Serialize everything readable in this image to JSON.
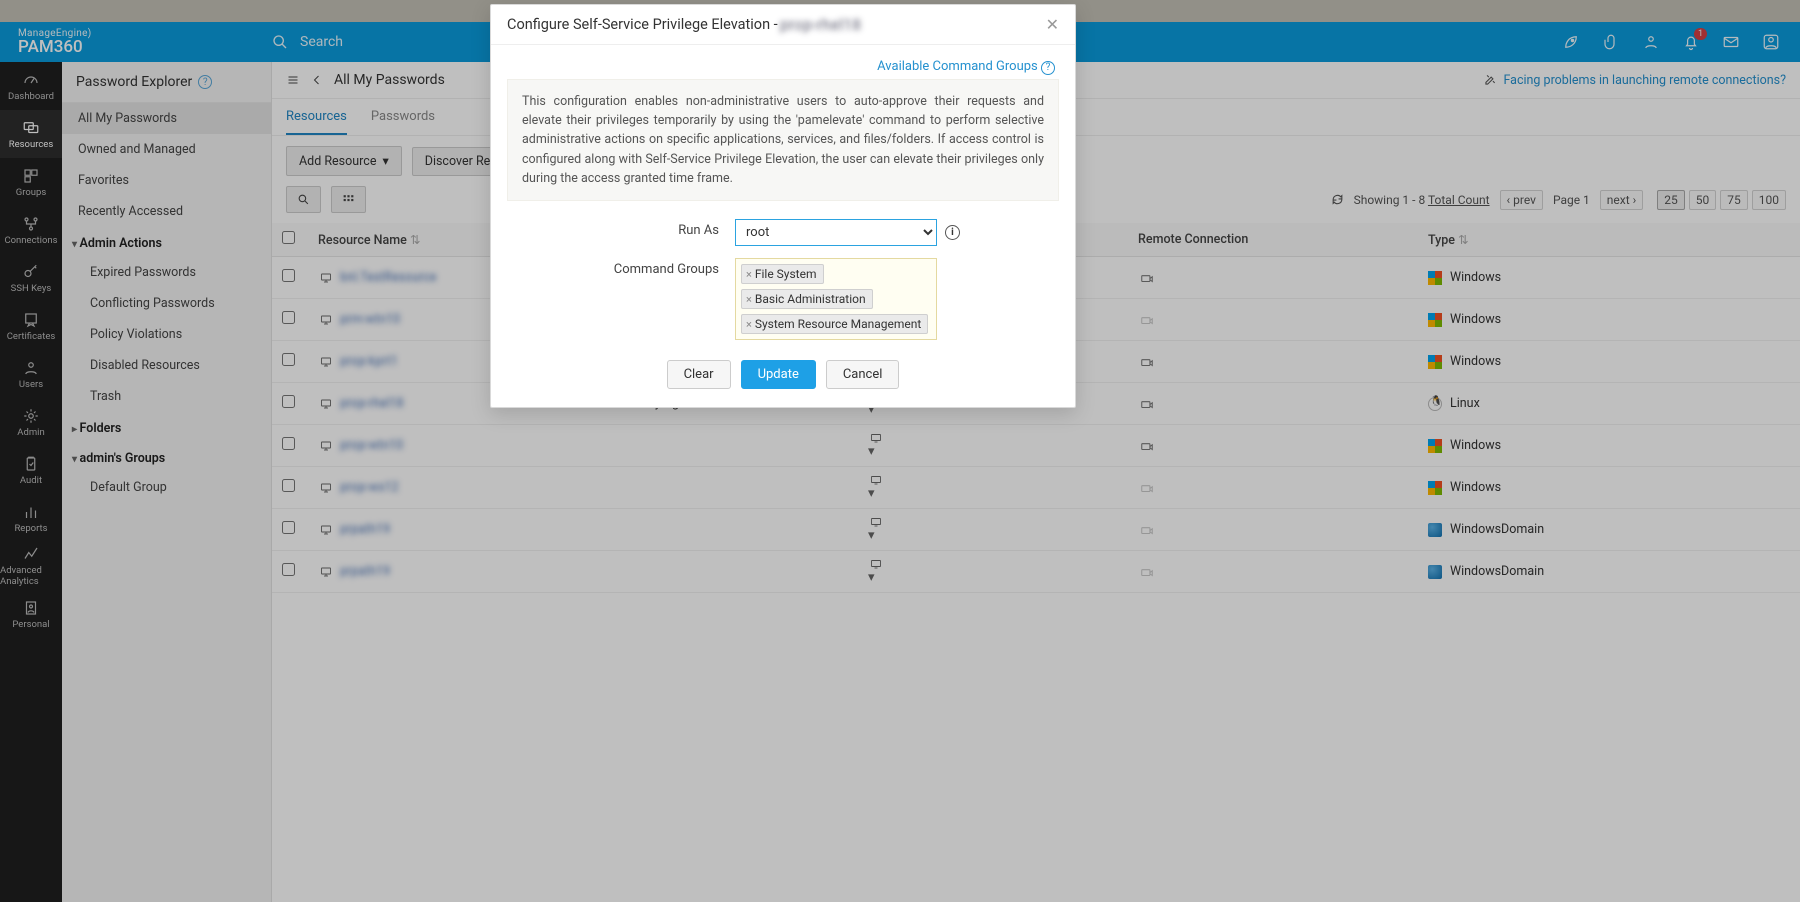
{
  "brand": {
    "sup": "ManageEngine)",
    "main": "PAM360"
  },
  "search": {
    "placeholder": "Search"
  },
  "header_icons": {
    "notifications_badge": "1"
  },
  "leftnav": [
    {
      "label": "Dashboard",
      "active": false,
      "icon": "gauge"
    },
    {
      "label": "Resources",
      "active": true,
      "icon": "monitors"
    },
    {
      "label": "Groups",
      "active": false,
      "icon": "groups"
    },
    {
      "label": "Connections",
      "active": false,
      "icon": "connections"
    },
    {
      "label": "SSH Keys",
      "active": false,
      "icon": "key"
    },
    {
      "label": "Certificates",
      "active": false,
      "icon": "cert"
    },
    {
      "label": "Users",
      "active": false,
      "icon": "user"
    },
    {
      "label": "Admin",
      "active": false,
      "icon": "gear"
    },
    {
      "label": "Audit",
      "active": false,
      "icon": "audit"
    },
    {
      "label": "Reports",
      "active": false,
      "icon": "reports"
    },
    {
      "label": "Advanced Analytics",
      "active": false,
      "icon": "analytics"
    },
    {
      "label": "Personal",
      "active": false,
      "icon": "personal"
    }
  ],
  "explorer": {
    "title": "Password Explorer",
    "items": [
      {
        "label": "All My Passwords",
        "active": true
      },
      {
        "label": "Owned and Managed"
      },
      {
        "label": "Favorites"
      },
      {
        "label": "Recently Accessed"
      }
    ],
    "admin_actions": {
      "title": "Admin Actions",
      "items": [
        "Expired Passwords",
        "Conflicting Passwords",
        "Policy Violations",
        "Disabled Resources",
        "Trash"
      ]
    },
    "folders": {
      "title": "Folders",
      "collapsed": true
    },
    "groups": {
      "title": "admin's Groups",
      "items": [
        "Default Group"
      ]
    }
  },
  "main": {
    "title": "All My Passwords",
    "help_link": "Facing problems in launching remote connections?",
    "tabs": [
      {
        "label": "Resources",
        "active": true
      },
      {
        "label": "Passwords",
        "active": false
      }
    ],
    "toolbar": {
      "add": "Add Resource",
      "discover": "Discover Resources"
    },
    "pager": {
      "showing": "Showing 1 - 8",
      "total_label": "Total Count",
      "prev": "prev",
      "page": "Page 1",
      "next": "next",
      "sizes": [
        "25",
        "50",
        "75",
        "100"
      ],
      "active_size": "25"
    },
    "columns": {
      "name": "Resource Name",
      "desc": "",
      "action": "",
      "remote": "Remote Connection",
      "type": "Type"
    },
    "rows": [
      {
        "name": "bnl.TestResource",
        "desc": "",
        "os": "win",
        "type": "Windows",
        "conn": "on"
      },
      {
        "name": "prm-wtn10",
        "desc": "",
        "os": "win",
        "type": "Windows",
        "conn": "dim"
      },
      {
        "name": "prop-kprt1",
        "desc": "",
        "os": "win",
        "type": "Windows",
        "conn": "on"
      },
      {
        "name": "prop-rhel18",
        "desc": "Added By Agent",
        "os": "linux",
        "type": "Linux",
        "conn": "on"
      },
      {
        "name": "prop-wtn10",
        "desc": "",
        "os": "win",
        "type": "Windows",
        "conn": "on"
      },
      {
        "name": "prop-ws12",
        "desc": "",
        "os": "win",
        "type": "Windows",
        "conn": "dim"
      },
      {
        "name": "prpath19",
        "desc": "",
        "os": "domain",
        "type": "WindowsDomain",
        "conn": "dim"
      },
      {
        "name": "prpath19",
        "desc": "",
        "os": "domain",
        "type": "WindowsDomain",
        "conn": "dim"
      }
    ]
  },
  "modal": {
    "title": "Configure Self-Service Privilege Elevation - ",
    "resource": "prop-rhel18",
    "link": "Available Command Groups",
    "desc": "This configuration enables non-administrative users to auto-approve their requests and elevate their privileges temporarily by using the 'pamelevate' command to perform selective administrative actions on specific applications, services, and files/folders. If access control is configured along with Self-Service Privilege Elevation, the user can elevate their privileges only during the access granted time frame.",
    "runas_label": "Run As",
    "runas_value": "root",
    "cmdgroups_label": "Command Groups",
    "tokens": [
      "File System",
      "Basic Administration",
      "System Resource Management"
    ],
    "actions": {
      "clear": "Clear",
      "update": "Update",
      "cancel": "Cancel"
    }
  }
}
